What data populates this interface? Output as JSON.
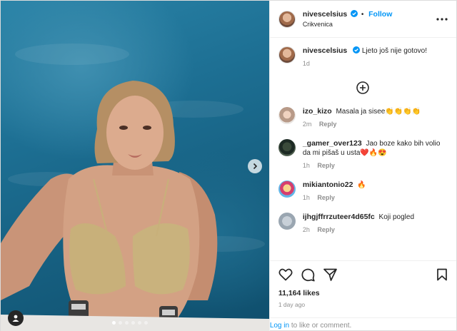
{
  "post": {
    "username": "nivescelsius",
    "follow_label": "Follow",
    "separator": "•",
    "location": "Crikvenica",
    "caption": "Ljeto još nije gotovo!",
    "caption_age": "1d",
    "likes": "11,164 likes",
    "posted_ago": "1 day ago",
    "login_link": "Log in",
    "login_rest": " to like or comment.",
    "carousel_dots": 6
  },
  "comments": [
    {
      "username": "izo_kizo",
      "text": "Masala ja sisee👏👏👏👏",
      "age": "2m",
      "reply": "Reply"
    },
    {
      "username": "_gamer_over123",
      "text": "Jao boze kako bih volio da mi pišaš u usta❤️🔥😍",
      "age": "1h",
      "reply": "Reply"
    },
    {
      "username": "mikiantonio22",
      "text": "🔥",
      "age": "1h",
      "reply": "Reply"
    },
    {
      "username": "ijhgjffrrzuteer4d65fc",
      "text": "Koji pogled",
      "age": "2h",
      "reply": "Reply"
    }
  ],
  "colors": {
    "link_blue": "#0095f6",
    "muted_gray": "#8e8e8e",
    "text": "#262626"
  },
  "icons": [
    "heart-icon",
    "comment-icon",
    "share-icon",
    "bookmark-icon",
    "more-icon",
    "verified-icon",
    "add-comment-icon",
    "chevron-right-icon",
    "user-tag-icon"
  ]
}
